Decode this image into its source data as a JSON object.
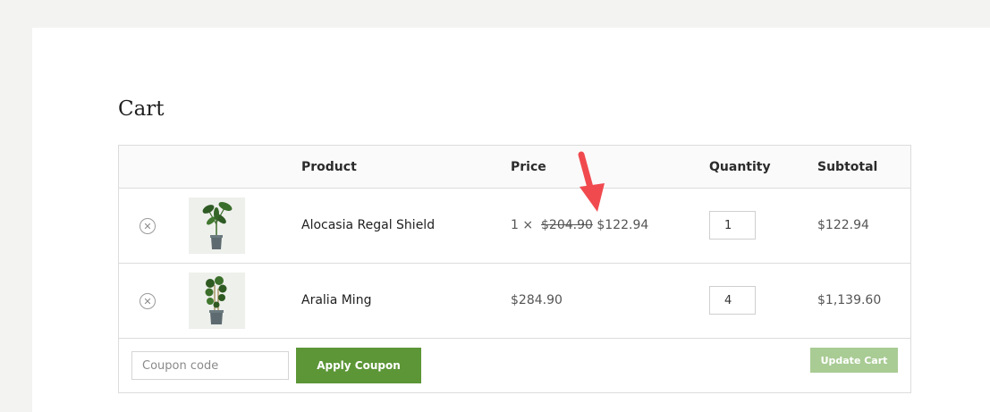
{
  "page": {
    "title": "Cart"
  },
  "table": {
    "headers": {
      "product": "Product",
      "price": "Price",
      "quantity": "Quantity",
      "subtotal": "Subtotal"
    }
  },
  "items": [
    {
      "name": "Alocasia Regal Shield",
      "price_prefix": "1 ×",
      "old_price": "$204.90",
      "price": "$122.94",
      "quantity": "1",
      "subtotal": "$122.94",
      "remove_symbol": "✕"
    },
    {
      "name": "Aralia Ming",
      "price": "$284.90",
      "quantity": "4",
      "subtotal": "$1,139.60",
      "remove_symbol": "✕"
    }
  ],
  "actions": {
    "coupon_placeholder": "Coupon code",
    "apply_coupon_label": "Apply Coupon",
    "update_cart_label": "Update Cart"
  },
  "colors": {
    "accent": "#5c9637",
    "accent_disabled": "#a9cb94",
    "annotation_arrow": "#f04a4f"
  },
  "icons": [
    "remove-item-icon",
    "annotation-arrow-icon"
  ]
}
